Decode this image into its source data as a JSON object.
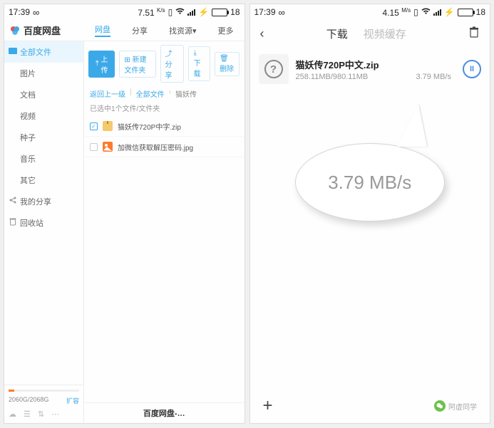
{
  "status": {
    "time": "17:39",
    "speed1": "7.51",
    "speed1_unit": "K/s",
    "speed2": "4.15",
    "speed2_unit": "M/s",
    "battery": "18"
  },
  "screen1": {
    "brand": "百度网盘",
    "tabs": {
      "t1": "网盘",
      "t2": "分享",
      "t3": "找资源",
      "t4": "更多"
    },
    "sidebar": {
      "all": "全部文件",
      "pic": "图片",
      "doc": "文档",
      "video": "视频",
      "seed": "种子",
      "music": "音乐",
      "other": "其它",
      "share": "我的分享",
      "recycle": "回收站"
    },
    "storage": {
      "text": "2060G/2068G",
      "expand": "扩容"
    },
    "toolbar": {
      "upload": "上传",
      "newfolder": "新建文件夹",
      "share": "分享",
      "download": "下载",
      "delete": "删除"
    },
    "crumbs": {
      "back": "返回上一级",
      "all": "全部文件",
      "cur": "猫妖传"
    },
    "meta": "已选中1个文件/文件夹",
    "files": {
      "f1": "猫妖传720P中字.zip",
      "f2": "加微信获取解压密码.jpg"
    },
    "footer": "百度网盘-…"
  },
  "screen2": {
    "nav": {
      "dl": "下载",
      "cache": "视频缓存"
    },
    "item": {
      "name": "猫妖传720P中文.zip",
      "progress": "258.11MB/980.11MB",
      "speed": "3.79 MB/s"
    },
    "callout": "3.79 MB/s",
    "watermark": "阿虚同学"
  }
}
